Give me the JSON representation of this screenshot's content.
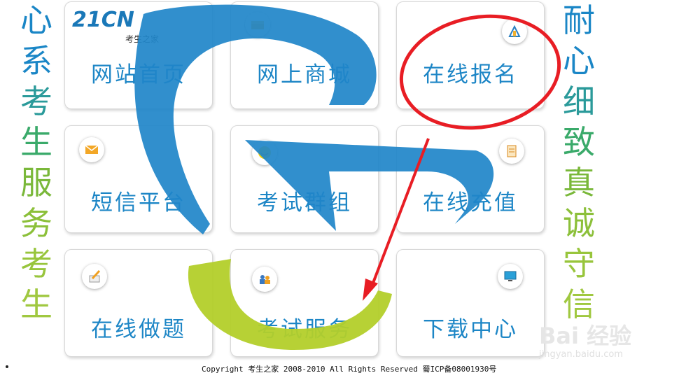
{
  "side_left": [
    "心",
    "系",
    "考",
    "生",
    "服",
    "务",
    "考",
    "生"
  ],
  "side_right": [
    "耐",
    "心",
    "细",
    "致",
    "真",
    "诚",
    "守",
    "信"
  ],
  "side_left_colors": [
    "#1a86c6",
    "#1a86c6",
    "#2a9a9a",
    "#3aaa6a",
    "#7ab83a",
    "#8cc03a",
    "#98c53c",
    "#a0c840"
  ],
  "side_right_colors": [
    "#1a86c6",
    "#1a86c6",
    "#2a9a9a",
    "#3aaa6a",
    "#7ab83a",
    "#8cc03a",
    "#98c53c",
    "#a0c840"
  ],
  "logo": {
    "text": "21CN",
    "sub": "考生之家"
  },
  "tiles": [
    {
      "label": "网站首页",
      "icon": ""
    },
    {
      "label": "网上商城",
      "icon": "box-icon"
    },
    {
      "label": "在线报名",
      "icon": "pencil-ruler-icon"
    },
    {
      "label": "短信平台",
      "icon": "envelope-icon"
    },
    {
      "label": "考试群组",
      "icon": "smile-icon"
    },
    {
      "label": "在线充值",
      "icon": "card-icon"
    },
    {
      "label": "在线做题",
      "icon": "paper-pen-icon"
    },
    {
      "label": "考试服务",
      "icon": "people-icon"
    },
    {
      "label": "下载中心",
      "icon": "monitor-icon"
    }
  ],
  "footer": "Copyright 考生之家 2008-2010 All Rights Reserved 蜀ICP备08001930号",
  "watermark": {
    "brand": "Bai 经验",
    "url": "jingyan.baidu.com"
  },
  "colors": {
    "blue": "#1d86c6",
    "green": "#b3cf2a",
    "annotation": "#e81d24"
  }
}
